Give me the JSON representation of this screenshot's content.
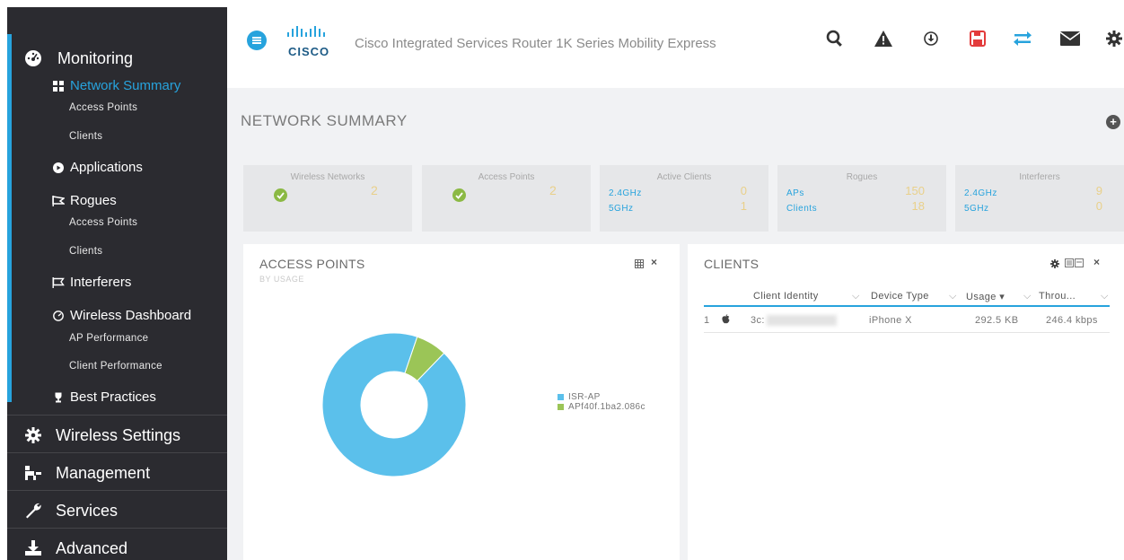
{
  "sidebar": {
    "monitoring": {
      "label": "Monitoring",
      "icon": "dashboard-gauge-icon",
      "network_summary": {
        "label": "Network Summary",
        "icon": "grid-icon"
      },
      "network_summary_children": [
        "Access Points",
        "Clients"
      ],
      "applications": {
        "label": "Applications",
        "icon": "applications-icon"
      },
      "rogues": {
        "label": "Rogues",
        "icon": "rogue-flag-icon"
      },
      "rogues_children": [
        "Access Points",
        "Clients"
      ],
      "interferers": {
        "label": "Interferers",
        "icon": "interferer-flag-icon"
      },
      "wireless_dashboard": {
        "label": "Wireless Dashboard",
        "icon": "dashboard-icon"
      },
      "wireless_dashboard_children": [
        "AP Performance",
        "Client Performance"
      ],
      "best_practices": {
        "label": "Best Practices",
        "icon": "trophy-icon"
      }
    },
    "wireless_settings": {
      "label": "Wireless Settings",
      "icon": "gear-icon"
    },
    "management": {
      "label": "Management",
      "icon": "sitemap-icon"
    },
    "services": {
      "label": "Services",
      "icon": "wrench-icon"
    },
    "advanced": {
      "label": "Advanced",
      "icon": "download-icon"
    }
  },
  "header": {
    "menu_icon": "hamburger-menu-icon",
    "logo_text": "CISCO",
    "app_title": "Cisco Integrated Services Router 1K Series Mobility Express",
    "toolbar_icons": [
      "search-icon",
      "alert-triangle-icon",
      "download-circle-icon",
      "save-icon",
      "transfer-icon",
      "mail-icon",
      "gear-icon"
    ],
    "save_icon_color": "#e33b3b",
    "transfer_icon_color": "#27a3dd"
  },
  "main": {
    "page_title": "NETWORK SUMMARY",
    "add_icon": "plus-circle-icon",
    "tiles": {
      "wireless_networks": {
        "label": "Wireless Networks",
        "value": "2"
      },
      "access_points": {
        "label": "Access Points",
        "value": "2"
      },
      "active_clients": {
        "label": "Active Clients",
        "row1_label": "2.4GHz",
        "row1_value": "0",
        "row2_label": "5GHz",
        "row2_value": "1"
      },
      "rogues": {
        "label": "Rogues",
        "row1_label": "APs",
        "row1_value": "150",
        "row2_label": "Clients",
        "row2_value": "18"
      },
      "interferers": {
        "label": "Interferers",
        "row1_label": "2.4GHz",
        "row1_value": "9",
        "row2_label": "5GHz",
        "row2_value": "0"
      }
    },
    "access_points_panel": {
      "title": "ACCESS POINTS",
      "subtitle": "BY USAGE",
      "controls": [
        "table-icon",
        "close-icon"
      ],
      "legend": [
        {
          "name": "ISR-AP",
          "color": "#5bc0eb"
        },
        {
          "name": "APf40f.1ba2.086c",
          "color": "#9bc557"
        }
      ]
    },
    "clients_panel": {
      "title": "CLIENTS",
      "controls": [
        "gear-icon",
        "export-icon",
        "close-icon"
      ],
      "columns": [
        "Client Identity",
        "Device Type",
        "Usage",
        "Throu..."
      ],
      "sort_indicator": "▾",
      "rows": [
        {
          "index": "1",
          "os_icon": "apple-icon",
          "identity": "3c:",
          "device_type": "iPhone X",
          "usage": "292.5 KB",
          "throughput": "246.4 kbps"
        }
      ]
    }
  },
  "chart_data": {
    "type": "pie",
    "title": "ACCESS POINTS",
    "subtitle": "BY USAGE",
    "categories": [
      "ISR-AP",
      "APf40f.1ba2.086c"
    ],
    "values": [
      93,
      7
    ],
    "colors": [
      "#5bc0eb",
      "#9bc557"
    ],
    "donut": true,
    "legend_position": "right"
  }
}
